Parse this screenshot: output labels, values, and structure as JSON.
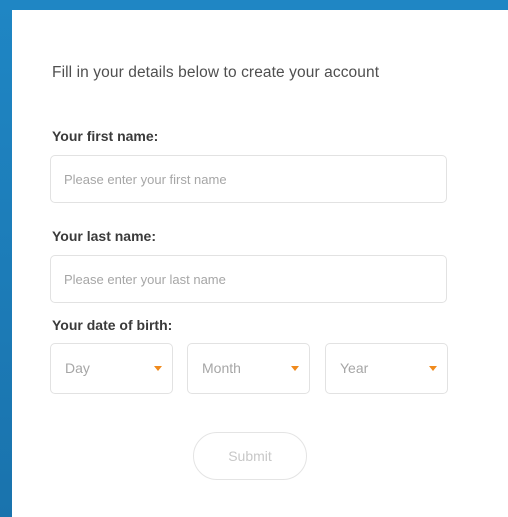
{
  "form": {
    "intro_text": "Fill in your details below to create your account",
    "first_name": {
      "label": "Your first name:",
      "placeholder": "Please enter your first name",
      "value": ""
    },
    "last_name": {
      "label": "Your last name:",
      "placeholder": "Please enter your last name",
      "value": ""
    },
    "date_of_birth": {
      "label": "Your date of birth:",
      "day": {
        "selected": "Day"
      },
      "month": {
        "selected": "Month"
      },
      "year": {
        "selected": "Year"
      }
    },
    "submit_label": "Submit"
  },
  "colors": {
    "border_frame": "#1c7ab5",
    "caret_accent": "#f08a1c"
  },
  "icons": {
    "dropdown": "chevron-down-icon"
  }
}
